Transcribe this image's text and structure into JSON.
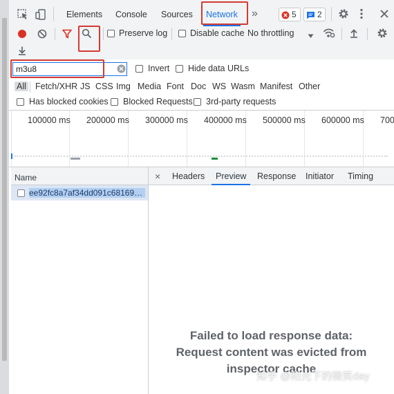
{
  "tabs": [
    "Elements",
    "Console",
    "Sources",
    "Network"
  ],
  "more_tabs": "»",
  "badges": {
    "errors": "5",
    "messages": "2"
  },
  "toolbar": {
    "preserve_log": "Preserve log",
    "disable_cache": "Disable cache",
    "throttling": "No throttling"
  },
  "filter": {
    "value": "m3u8",
    "invert": "Invert",
    "hide_data_urls": "Hide data URLs",
    "types": [
      "All",
      "Fetch/XHR",
      "JS",
      "CSS",
      "Img",
      "Media",
      "Font",
      "Doc",
      "WS",
      "Wasm",
      "Manifest",
      "Other"
    ],
    "has_blocked_cookies": "Has blocked cookies",
    "blocked_requests": "Blocked Requests",
    "third_party": "3rd-party requests"
  },
  "overview": {
    "ticks": [
      "100000 ms",
      "200000 ms",
      "300000 ms",
      "400000 ms",
      "500000 ms",
      "600000 ms",
      "700"
    ]
  },
  "requests": {
    "column_name": "Name",
    "rows": [
      {
        "name": "ee92fc8a7af34dd091c68169a..."
      }
    ]
  },
  "detail": {
    "close": "×",
    "tabs": [
      "Headers",
      "Preview",
      "Response",
      "Initiator",
      "Timing"
    ],
    "active_tab": "Preview",
    "error_line1": "Failed to load response data:",
    "error_line2": "Request content was evicted from",
    "error_line3": "inspector cache"
  },
  "watermark": "知乎 @阳光下的微笑day",
  "colors": {
    "accent": "#1a73e8",
    "record": "#d93025",
    "highlight_box": "#d33a31",
    "selected_row": "#dde6f4"
  }
}
